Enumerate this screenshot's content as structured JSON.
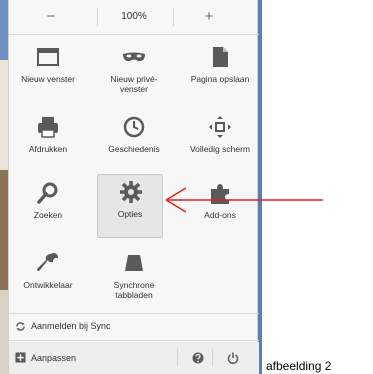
{
  "zoom": {
    "minus": "−",
    "value": "100%",
    "plus": "+"
  },
  "grid": [
    {
      "label": "Nieuw venster",
      "icon": "new-window-icon"
    },
    {
      "label": "Nieuw privé-venster",
      "icon": "private-mask-icon"
    },
    {
      "label": "Pagina opslaan",
      "icon": "save-page-icon"
    },
    {
      "label": "Afdrukken",
      "icon": "printer-icon"
    },
    {
      "label": "Geschiedenis",
      "icon": "history-clock-icon"
    },
    {
      "label": "Volledig scherm",
      "icon": "fullscreen-icon"
    },
    {
      "label": "Zoeken",
      "icon": "search-icon"
    },
    {
      "label": "Opties",
      "icon": "gear-icon"
    },
    {
      "label": "Add-ons",
      "icon": "puzzle-icon"
    },
    {
      "label": "Ontwikkelaar",
      "icon": "wrench-icon"
    },
    {
      "label": "Synchrone tabbladen",
      "icon": "synced-tabs-icon"
    }
  ],
  "footer": {
    "sync_label": "Aanmelden bij Sync",
    "customize_label": "Aanpassen"
  },
  "caption": "afbeelding 2",
  "colors": {
    "arrow": "#e02020",
    "menu_bg": "#f7f7f7",
    "icon": "#5a5a5a"
  }
}
